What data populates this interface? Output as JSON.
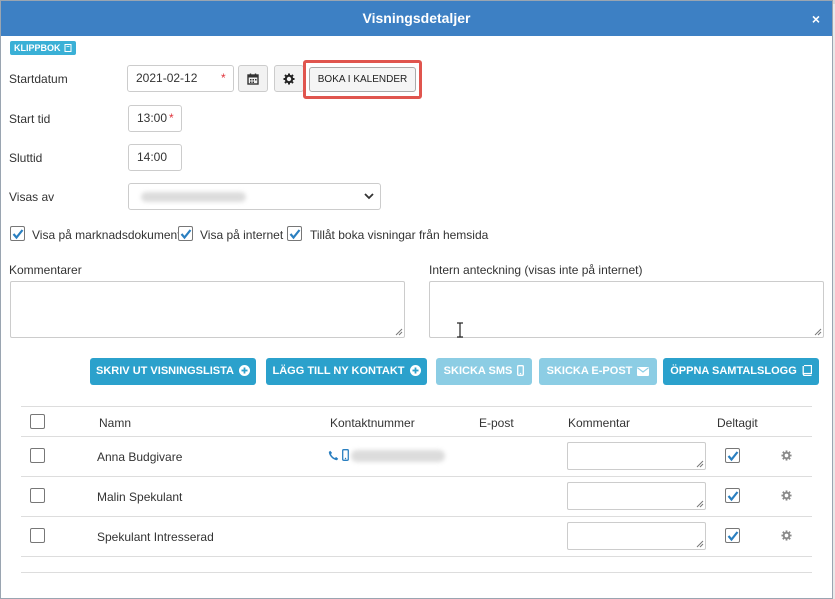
{
  "modal": {
    "title": "Visningsdetaljer",
    "close_label": "×"
  },
  "clipboard_label": "KLIPPBOK",
  "form": {
    "startdatum_label": "Startdatum",
    "startdatum_value": "2021-02-12",
    "required_mark": "*",
    "book_calendar_label": "BOKA I KALENDER",
    "start_tid_label": "Start tid",
    "start_tid_value": "13:00",
    "sluttid_label": "Sluttid",
    "sluttid_value": "14:00",
    "visas_av_label": "Visas av"
  },
  "checkboxes": [
    {
      "label": "Visa på marknadsdokument",
      "checked": true
    },
    {
      "label": "Visa på internet",
      "checked": true
    },
    {
      "label": "Tillåt boka visningar från hemsida",
      "checked": true
    }
  ],
  "comments_label": "Kommentarer",
  "internal_note_label": "Intern anteckning (visas inte på internet)",
  "actions": {
    "print_list": "SKRIV UT VISNINGSLISTA",
    "add_contact": "LÄGG TILL NY KONTAKT",
    "send_sms": "SKICKA SMS",
    "send_email": "SKICKA E-POST",
    "open_call_log": "ÖPPNA SAMTALSLOGG"
  },
  "table": {
    "headers": {
      "name": "Namn",
      "phone": "Kontaktnummer",
      "email": "E-post",
      "comment": "Kommentar",
      "attended": "Deltagit"
    },
    "rows": [
      {
        "name": "Anna Budgivare",
        "has_phone": true,
        "attended": true
      },
      {
        "name": "Malin Spekulant",
        "has_phone": false,
        "attended": true
      },
      {
        "name": "Spekulant Intresserad",
        "has_phone": false,
        "attended": true
      }
    ]
  },
  "colors": {
    "header": "#3d80c4",
    "button": "#2ba1cc",
    "button_disabled": "#8ccde4",
    "highlight": "#e0554e",
    "check": "#2a7fc0"
  }
}
